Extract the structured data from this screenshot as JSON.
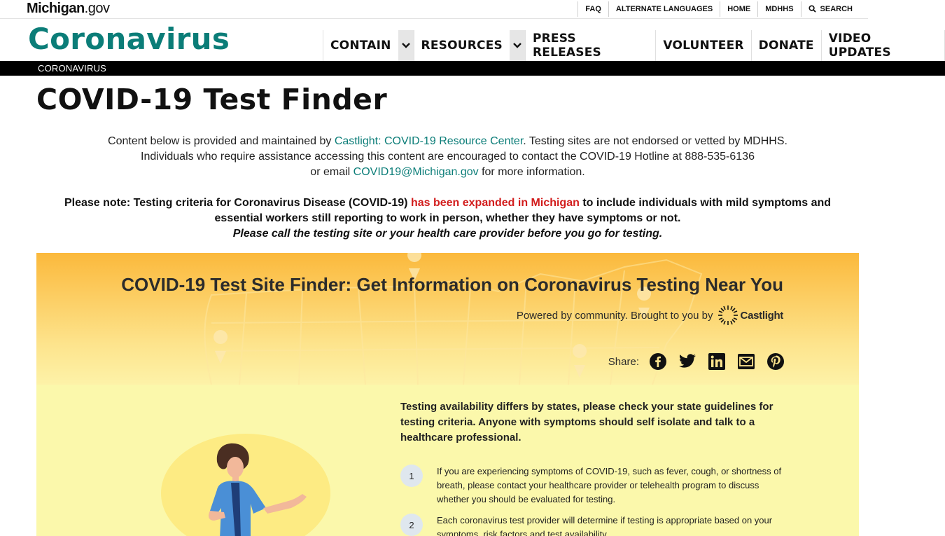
{
  "brand": {
    "name": "Michigan",
    "suffix": ".gov"
  },
  "utility_nav": [
    {
      "label": "FAQ"
    },
    {
      "label": "ALTERNATE LANGUAGES"
    },
    {
      "label": "HOME"
    },
    {
      "label": "MDHHS"
    },
    {
      "label": "SEARCH",
      "icon": "search-icon"
    }
  ],
  "site_title": "Coronavirus",
  "main_nav": [
    {
      "label": "CONTAIN",
      "dropdown": true
    },
    {
      "label": "RESOURCES",
      "dropdown": true
    },
    {
      "label": "PRESS RELEASES",
      "dropdown": false
    },
    {
      "label": "VOLUNTEER",
      "dropdown": false
    },
    {
      "label": "DONATE",
      "dropdown": false
    },
    {
      "label": "VIDEO UPDATES",
      "dropdown": false
    }
  ],
  "breadcrumb": "CORONAVIRUS",
  "page_title": "COVID-19 Test Finder",
  "intro": {
    "p1_before": "Content below is provided and maintained by ",
    "p1_link": "Castlight: COVID-19 Resource Center",
    "p1_after": ". Testing sites are not endorsed or vetted by MDHHS.",
    "p2": "Individuals who require assistance accessing this content are encouraged to contact the COVID-19 Hotline at 888-535-6136",
    "p3_before": "or email ",
    "p3_link": "COVID19@Michigan.gov",
    "p3_after": " for more information."
  },
  "note": {
    "before": "Please note: Testing criteria for Coronavirus Disease (COVID-19) ",
    "highlight": "has been expanded in Michigan",
    "after": " to include individuals with mild symptoms and essential workers still reporting to work in person, whether they have symptoms or not.",
    "italic": "Please call the testing site or your health care provider before you go for testing."
  },
  "widget": {
    "title": "COVID-19 Test Site Finder: Get Information on Coronavirus Testing Near You",
    "powered_by": "Powered by community. Brought to you by",
    "partner": "Castlight",
    "share_label": "Share:",
    "share_icons": [
      "facebook-icon",
      "twitter-icon",
      "linkedin-icon",
      "email-icon",
      "pinterest-icon"
    ],
    "lead": "Testing availability differs by states, please check your state guidelines for testing criteria. Anyone with symptoms should self isolate and talk to a healthcare professional.",
    "steps": [
      {
        "num": "1",
        "text": "If you are experiencing symptoms of COVID-19, such as fever, cough, or shortness of breath, please contact your healthcare provider or telehealth program to discuss whether you should be evaluated for testing."
      },
      {
        "num": "2",
        "text": "Each coronavirus test provider will determine if testing is appropriate based on your symptoms, risk factors and test availability."
      }
    ]
  },
  "colors": {
    "teal": "#0b7d78",
    "red": "#d21d1d",
    "banner_top": "#fbb93c",
    "panel": "#fbf8ab"
  }
}
